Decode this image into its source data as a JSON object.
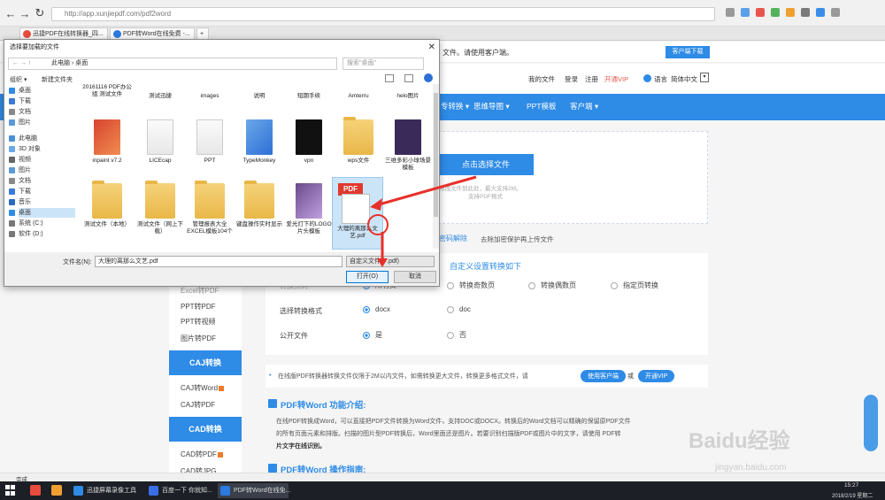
{
  "browser": {
    "url": "http://app.xunjiepdf.com/pdf2word",
    "url_domain": "app.xunjiepdf.com",
    "tabs": [
      {
        "label": "迅捷PDF在线转换器_四..."
      },
      {
        "label": "PDF转Word在线免费 -..."
      }
    ],
    "new_tab": "+"
  },
  "page": {
    "top_notice": "文件。请使用客户端。",
    "client_download": "客户端下载",
    "header_links": [
      "我的文件",
      "登录",
      "注册",
      "开通VIP"
    ],
    "language_label": "语言",
    "language_value": "简体中文",
    "nav": [
      "专转换",
      "思维导图",
      "PPT模板",
      "客户端"
    ],
    "upload_button": "点击选择文件",
    "upload_hint1": "拖拽文件到此处，最大支持2M。",
    "upload_hint2": "支持PDF格式",
    "decrypt_link": "密码解除",
    "decrypt_hint": "去除加密保护再上传文件",
    "custom_settings": "自定义设置转换如下",
    "row_pages": {
      "label": "转换页码",
      "options": [
        "所有页",
        "转换奇数页",
        "转换偶数页",
        "指定页转换"
      ]
    },
    "row_format": {
      "label": "选择转换格式",
      "options": [
        "docx",
        "doc"
      ]
    },
    "row_public": {
      "label": "公开文件",
      "options": [
        "是",
        "否"
      ]
    },
    "notice": "在线版PDF转换器转换文件仅限于2M以内文件，如需转换更大文件，转换更多格式文件，请",
    "notice_btn1": "使用客户端",
    "notice_or": "或",
    "notice_btn2": "开通VIP",
    "intro_title": "PDF转Word 功能介绍:",
    "intro_text1": "在线PDF转换成Word，可以直接把PDF文件转换为Word文件，支持DOC或DOCX。转换后的Word文档可以精确的保留原PDF文件",
    "intro_text2": "的所有页面元素和排版。扫描的图片型PDF转换后，Word里面还是图片。若要识别扫描版PDF或图片中的文字，请使用 PDF转",
    "intro_text3": "片文字在线识别。",
    "guide_title": "PDF转Word 操作指南:",
    "sidebar": {
      "items_top": [
        "Excel转PDF",
        "PPT转PDF",
        "PPT转视频",
        "图片转PDF"
      ],
      "section_caj": "CAJ转换",
      "items_caj": [
        "CAJ转Word",
        "CAJ转PDF"
      ],
      "section_cad": "CAD转换",
      "items_cad": [
        "CAD转PDF",
        "CAD转JPG"
      ]
    },
    "watermark": "Baidu经验",
    "watermark_url": "jingyan.baidu.com"
  },
  "dialog": {
    "title": "选择要加载的文件",
    "address": "此电脑 › 桌面",
    "search_placeholder": "搜索\"桌面\"",
    "organize": "组织 ▾",
    "new_folder": "新建文件夹",
    "nav_items": [
      "桌面",
      "下载",
      "文档",
      "图片",
      "此电脑",
      "3D 对象",
      "视频",
      "图片",
      "文档",
      "下载",
      "音乐",
      "桌面",
      "系统 (C:)",
      "软件 (D:)"
    ],
    "files_row1": [
      "20161116 PDF办公组 测试文件",
      "测试迅捷",
      "images",
      "说明",
      "短期手续",
      "Amterru",
      "helo图片"
    ],
    "files_row2": [
      "inpaint v7.2",
      "LICEcap",
      "PPT",
      "TypeMonkey",
      "vpn",
      "wps文件",
      "三维多彩小球场景模板"
    ],
    "files_row3": [
      "测试文件（本地）",
      "测试文件（网上下载）",
      "管理报表大全EXCEL模板104个",
      "键盘操作实时显示",
      "爱光灯下的LOGO片头模板",
      "大理的离那么文艺.pdf"
    ],
    "filename_label": "文件名(N):",
    "filename_value": "大理的离那么文艺.pdf",
    "filetype": "自定义文件 (*.pdf)",
    "open_button": "打开(O)",
    "cancel_button": "取消"
  },
  "taskbar": {
    "items": [
      "迅捷屏幕录像工具",
      "百度一下 你就知...",
      "PDF转Word在线免..."
    ],
    "time": "15:27",
    "date": "2018/2/19 星期二"
  },
  "status": {
    "left": "完成"
  }
}
